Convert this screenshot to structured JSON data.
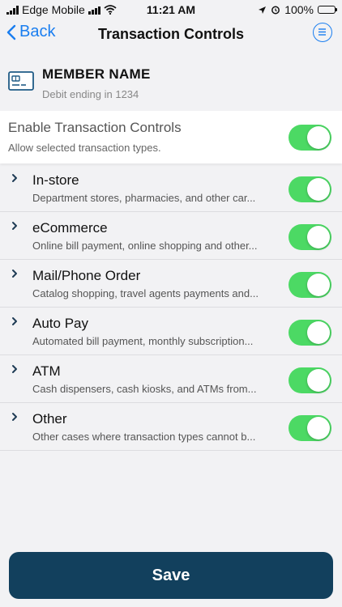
{
  "status_bar": {
    "carrier": "Edge Mobile",
    "time": "11:21 AM",
    "battery": "100%",
    "battery_level": 1.0
  },
  "nav": {
    "back_label": "Back",
    "title": "Transaction Controls",
    "menu_icon": "list-circle-icon"
  },
  "account": {
    "name": "MEMBER NAME",
    "subtitle": "Debit ending in 1234",
    "icon": "credit-card-icon"
  },
  "master_toggle": {
    "title": "Enable Transaction Controls",
    "subtitle": "Allow selected transaction types.",
    "on": true
  },
  "categories": [
    {
      "title": "In-store",
      "subtitle": "Department stores, pharmacies, and other car...",
      "on": true
    },
    {
      "title": "eCommerce",
      "subtitle": "Online bill payment, online shopping and other...",
      "on": true
    },
    {
      "title": "Mail/Phone Order",
      "subtitle": "Catalog shopping, travel agents payments and...",
      "on": true
    },
    {
      "title": "Auto Pay",
      "subtitle": "Automated bill payment, monthly subscription...",
      "on": true
    },
    {
      "title": "ATM",
      "subtitle": "Cash dispensers, cash kiosks, and ATMs from...",
      "on": true
    },
    {
      "title": "Other",
      "subtitle": "Other cases where transaction types cannot b...",
      "on": true
    }
  ],
  "save_label": "Save",
  "colors": {
    "accent": "#1a7ef0",
    "toggle_on": "#4cd964",
    "save_button": "#12405d",
    "background": "#f2f2f4"
  }
}
